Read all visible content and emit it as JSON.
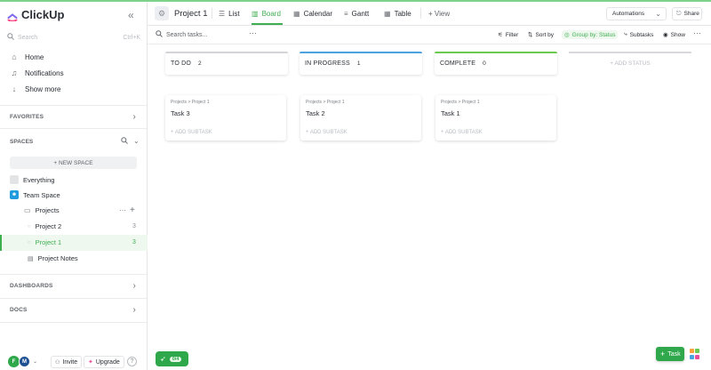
{
  "brand": {
    "name": "ClickUp"
  },
  "sidebar": {
    "search_placeholder": "Search",
    "search_shortcut": "Ctrl+K",
    "nav": [
      {
        "label": "Home",
        "icon": "home-icon"
      },
      {
        "label": "Notifications",
        "icon": "bell-icon"
      },
      {
        "label": "Show more",
        "icon": "arrow-down-icon"
      }
    ],
    "favorites_label": "FAVORITES",
    "spaces_label": "SPACES",
    "new_space_label": "+ NEW SPACE",
    "everything_label": "Everything",
    "team_space_label": "Team Space",
    "folder_label": "Projects",
    "lists": [
      {
        "label": "Project 2",
        "count": "3"
      },
      {
        "label": "Project 1",
        "count": "3"
      }
    ],
    "doc_label": "Project Notes",
    "dashboards_label": "DASHBOARDS",
    "docs_label": "DOCS",
    "footer": {
      "avatar1": "F",
      "avatar2": "M",
      "invite_label": "Invite",
      "upgrade_label": "Upgrade",
      "help_label": "?"
    }
  },
  "header": {
    "title": "Project 1",
    "tabs": [
      {
        "label": "List",
        "icon": "list-icon"
      },
      {
        "label": "Board",
        "icon": "board-icon",
        "active": true
      },
      {
        "label": "Calendar",
        "icon": "calendar-icon"
      },
      {
        "label": "Gantt",
        "icon": "gantt-icon"
      },
      {
        "label": "Table",
        "icon": "table-icon"
      }
    ],
    "add_view_label": "+ View",
    "automations_label": "Automations",
    "share_label": "Share"
  },
  "toolbar": {
    "search_placeholder": "Search tasks...",
    "more_label": "···",
    "filter_label": "Filter",
    "sort_label": "Sort by",
    "group_label": "Group by: Status",
    "subtasks_label": "Subtasks",
    "show_label": "Show",
    "overflow_label": "···"
  },
  "board": {
    "columns": [
      {
        "name": "TO DO",
        "count": "2",
        "color": "#d3d5d8",
        "cards": [
          {
            "crumb": "Projects > Project 1",
            "title": "Task 3",
            "add_subtask": "+ ADD SUBTASK"
          }
        ]
      },
      {
        "name": "IN PROGRESS",
        "count": "1",
        "color": "#4aa3df",
        "cards": [
          {
            "crumb": "Projects > Project 1",
            "title": "Task 2",
            "add_subtask": "+ ADD SUBTASK"
          }
        ]
      },
      {
        "name": "COMPLETE",
        "count": "0",
        "color": "#6bc950",
        "cards": [
          {
            "crumb": "Projects > Project 1",
            "title": "Task 1",
            "add_subtask": "+ ADD SUBTASK"
          }
        ]
      }
    ],
    "add_status_label": "+ ADD STATUS"
  },
  "bottom": {
    "rocket_badge": "0/4",
    "task_button_label": "Task"
  },
  "colors": {
    "accent": "#3fae50",
    "brand_green": "#2ea84a"
  }
}
